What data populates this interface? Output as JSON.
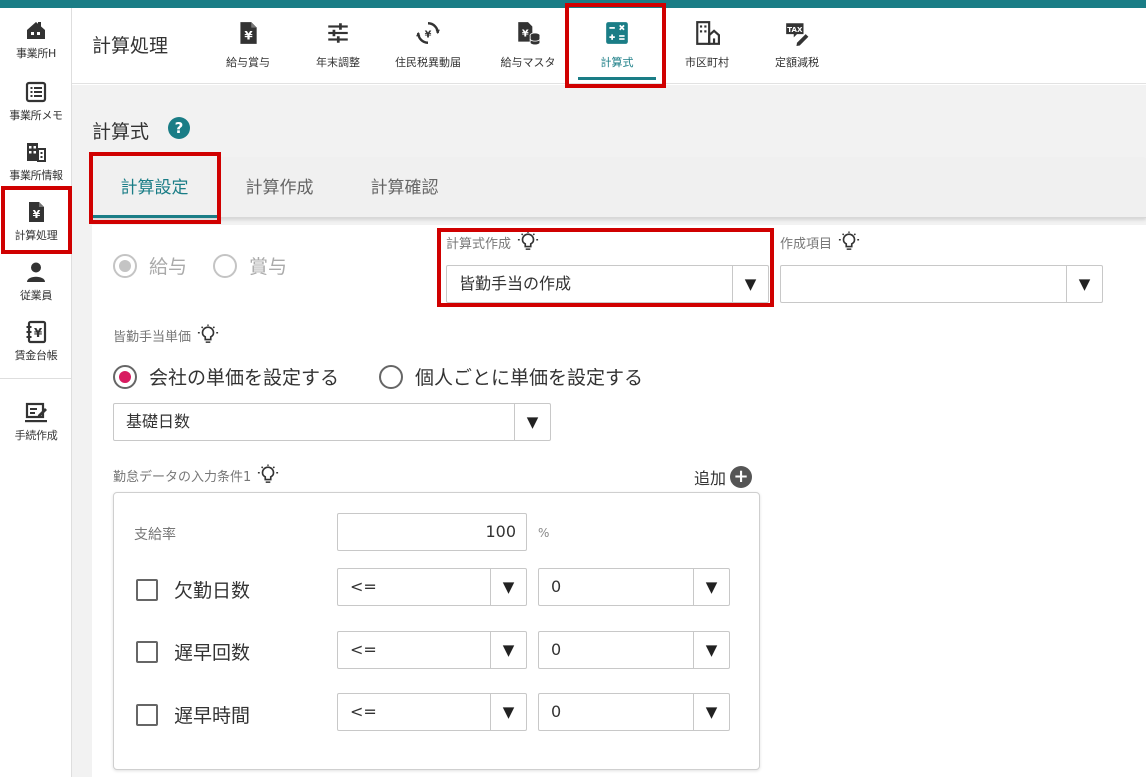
{
  "sidebar": {
    "items": [
      {
        "label": "事業所H",
        "icon": "office-home-icon"
      },
      {
        "label": "事業所メモ",
        "icon": "memo-list-icon"
      },
      {
        "label": "事業所情報",
        "icon": "building-icon"
      },
      {
        "label": "計算処理",
        "icon": "yen-document-icon"
      },
      {
        "label": "従業員",
        "icon": "person-icon"
      },
      {
        "label": "賃金台帳",
        "icon": "ledger-icon"
      },
      {
        "label": "手続作成",
        "icon": "form-edit-icon"
      }
    ]
  },
  "header": {
    "title": "計算処理",
    "nav": [
      {
        "label": "給与賞与",
        "icon": "yen-document-icon"
      },
      {
        "label": "年末調整",
        "icon": "sliders-icon"
      },
      {
        "label": "住民税異動届",
        "icon": "transfer-icon"
      },
      {
        "label": "給与マスタ",
        "icon": "yen-database-icon"
      },
      {
        "label": "計算式",
        "icon": "calculator-icon"
      },
      {
        "label": "市区町村",
        "icon": "city-building-icon"
      },
      {
        "label": "定額減税",
        "icon": "tax-edit-icon"
      }
    ],
    "active_nav": "計算式"
  },
  "page": {
    "title": "計算式",
    "help": "?",
    "tabs": [
      {
        "label": "計算設定"
      },
      {
        "label": "計算作成"
      },
      {
        "label": "計算確認"
      }
    ],
    "active_tab": "計算設定"
  },
  "form": {
    "pay_type": {
      "options": [
        "給与",
        "賞与"
      ],
      "selected": "給与",
      "disabled": true
    },
    "formula_create": {
      "label": "計算式作成",
      "value": "皆勤手当の作成"
    },
    "create_item": {
      "label": "作成項目",
      "value": ""
    },
    "unit_price": {
      "label": "皆勤手当単価",
      "options": [
        "会社の単価を設定する",
        "個人ごとに単価を設定する"
      ],
      "selected": "会社の単価を設定する",
      "basis_value": "基礎日数"
    },
    "conditions": {
      "label": "勤怠データの入力条件1",
      "add_label": "追加",
      "pay_rate": {
        "label": "支給率",
        "value": "100",
        "unit": "%"
      },
      "rows": [
        {
          "label": "欠勤日数",
          "operator": "<=",
          "value": "0",
          "checked": false
        },
        {
          "label": "遅早回数",
          "operator": "<=",
          "value": "0",
          "checked": false
        },
        {
          "label": "遅早時間",
          "operator": "<=",
          "value": "0",
          "checked": false
        }
      ]
    }
  },
  "colors": {
    "accent": "#1a7d86",
    "radio_on": "#d81b60",
    "highlight": "#d00000"
  }
}
